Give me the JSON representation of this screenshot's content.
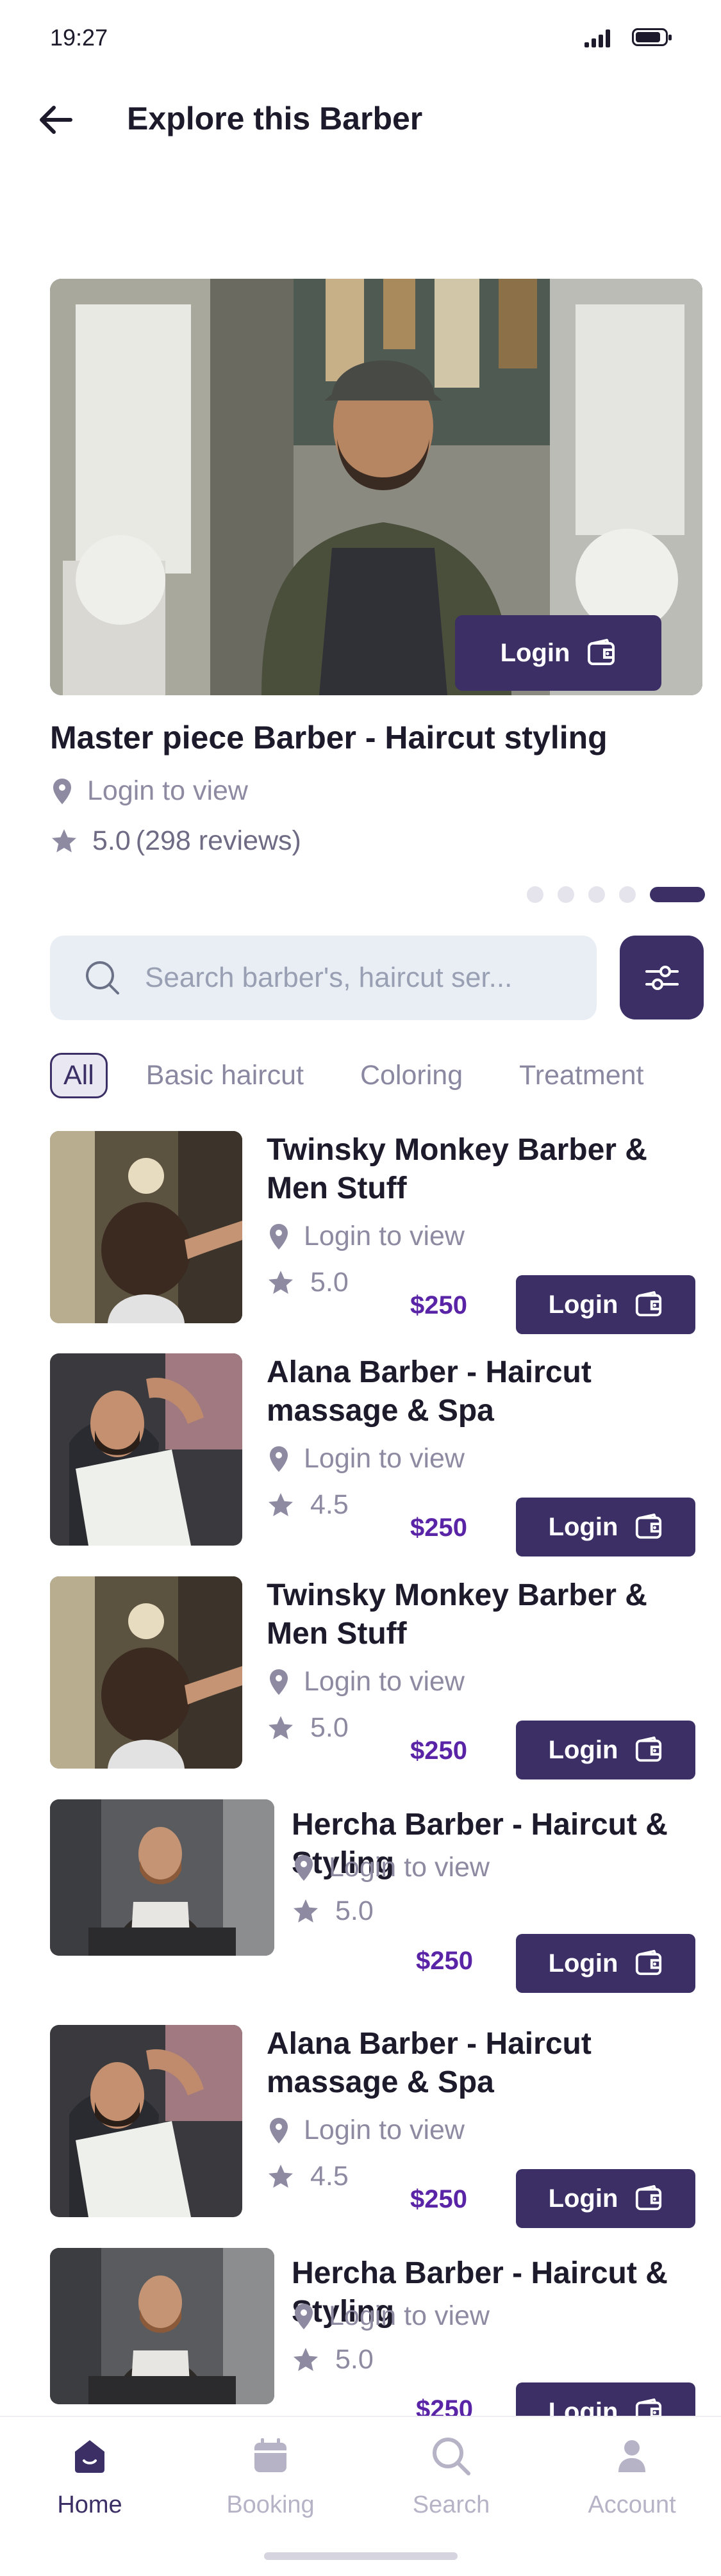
{
  "status_bar": {
    "time": "19:27"
  },
  "header": {
    "title": "Explore this Barber"
  },
  "hero": {
    "login_label": "Login"
  },
  "featured": {
    "title": "Master piece Barber - Haircut styling",
    "location": "Login to view",
    "rating": "5.0",
    "reviews": "(298 reviews)"
  },
  "carousel": {
    "total": 5,
    "active": 5
  },
  "search": {
    "placeholder": "Search barber's, haircut ser..."
  },
  "chips": [
    "All",
    "Basic haircut",
    "Coloring",
    "Treatment"
  ],
  "barbers": [
    {
      "name": "Twinsky Monkey Barber & Men Stuff",
      "location": "Login to view",
      "rating": "5.0",
      "price": "$250",
      "login": "Login"
    },
    {
      "name": "Alana Barber - Haircut massage & Spa",
      "location": "Login to view",
      "rating": "4.5",
      "price": "$250",
      "login": "Login"
    },
    {
      "name": "Twinsky Monkey Barber & Men Stuff",
      "location": "Login to view",
      "rating": "5.0",
      "price": "$250",
      "login": "Login"
    },
    {
      "name": "Hercha Barber - Haircut & Styling",
      "location": "Login to view",
      "rating": "5.0",
      "price": "$250",
      "login": "Login"
    },
    {
      "name": "Alana Barber - Haircut massage & Spa",
      "location": "Login to view",
      "rating": "4.5",
      "price": "$250",
      "login": "Login"
    },
    {
      "name": "Hercha Barber - Haircut & Styling",
      "location": "Login to view",
      "rating": "5.0",
      "price": "$250",
      "login": "Login"
    }
  ],
  "nav": {
    "home": "Home",
    "booking": "Booking",
    "search": "Search",
    "account": "Account"
  },
  "colors": {
    "primary": "#3b2f66",
    "price": "#5a24a6",
    "muted": "#8e8aa2",
    "search_bg": "#e9eef4"
  }
}
